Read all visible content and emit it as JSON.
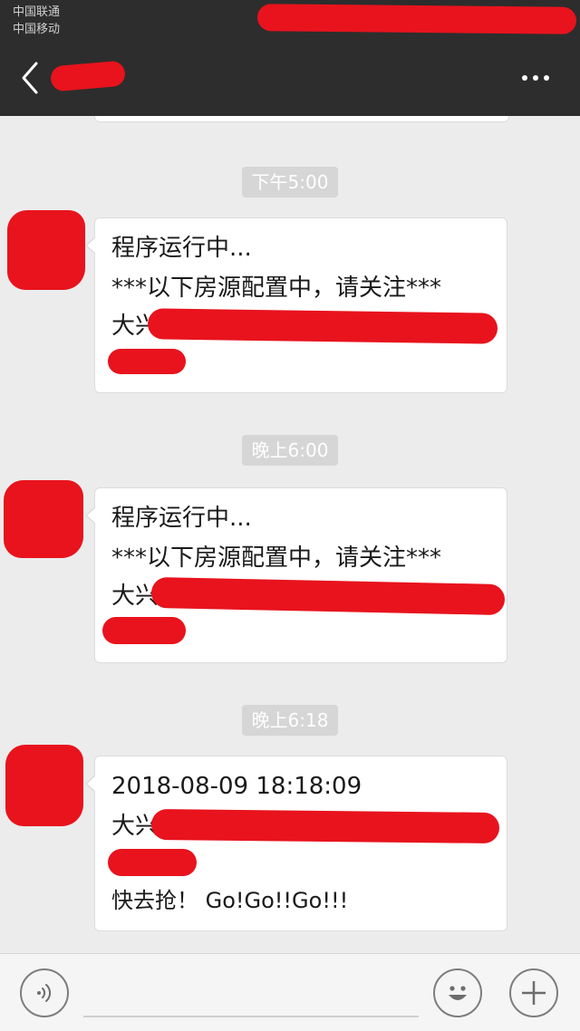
{
  "status_bar": {
    "carrier_1": "中国联通",
    "carrier_2": "中国移动"
  },
  "nav": {
    "back_icon": "chevron-left-icon",
    "more_icon": "more-dots-icon"
  },
  "messages": [
    {
      "time": "下午5:00",
      "lines": [
        "程序运行中...",
        "***以下房源配置中，请关注***",
        "大兴"
      ]
    },
    {
      "time": "晚上6:00",
      "lines": [
        "程序运行中...",
        "***以下房源配置中，请关注***",
        "大兴"
      ]
    },
    {
      "time": "晚上6:18",
      "lines": [
        "2018-08-09 18:18:09",
        "大兴",
        "快去抢！ Go!Go!!Go!!!"
      ]
    }
  ],
  "input_bar": {
    "voice_icon": "voice-icon",
    "emoji_icon": "emoji-icon",
    "add_icon": "plus-icon"
  },
  "colors": {
    "header_bg": "#2d2d2d",
    "chat_bg": "#ececec",
    "redaction": "#e8131d",
    "time_pill_bg": "#d6d6d6"
  }
}
